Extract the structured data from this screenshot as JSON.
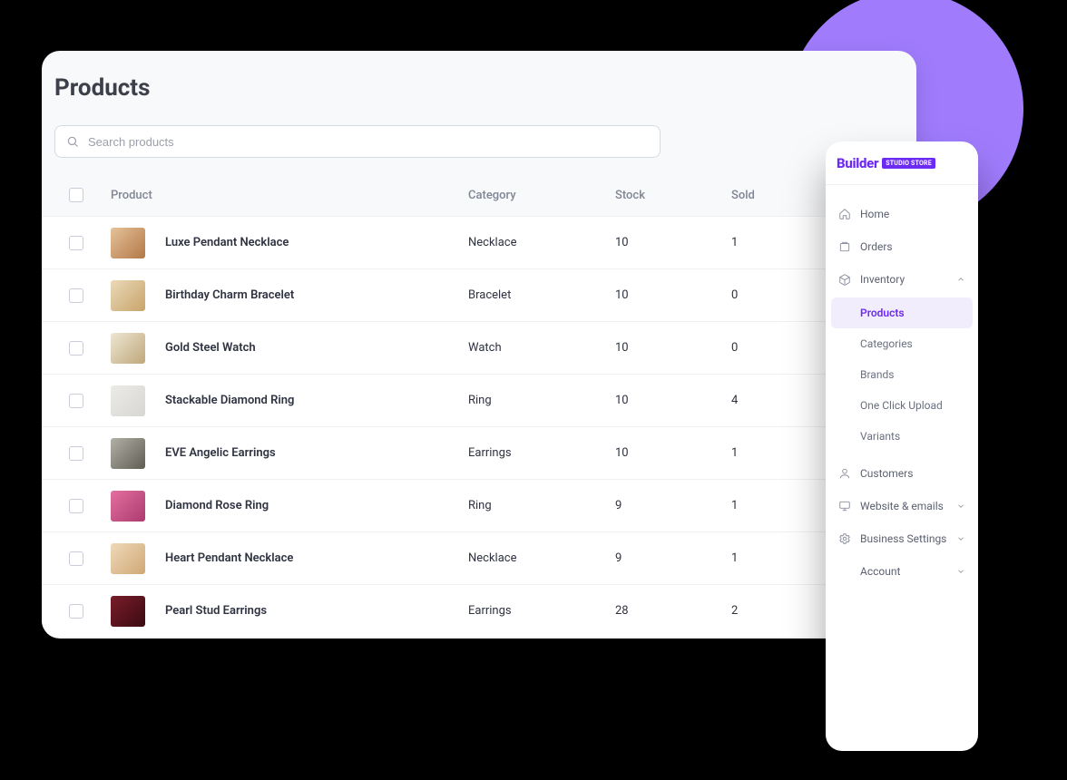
{
  "page": {
    "title": "Products",
    "search_placeholder": "Search products"
  },
  "columns": {
    "product": "Product",
    "category": "Category",
    "stock": "Stock",
    "sold": "Sold"
  },
  "products": [
    {
      "name": "Luxe Pendant Necklace",
      "category": "Necklace",
      "stock": "10",
      "sold": "1"
    },
    {
      "name": "Birthday Charm Bracelet",
      "category": "Bracelet",
      "stock": "10",
      "sold": "0"
    },
    {
      "name": "Gold Steel Watch",
      "category": "Watch",
      "stock": "10",
      "sold": "0"
    },
    {
      "name": "Stackable Diamond Ring",
      "category": "Ring",
      "stock": "10",
      "sold": "4"
    },
    {
      "name": "EVE Angelic Earrings",
      "category": "Earrings",
      "stock": "10",
      "sold": "1"
    },
    {
      "name": "Diamond Rose Ring",
      "category": "Ring",
      "stock": "9",
      "sold": "1"
    },
    {
      "name": "Heart Pendant Necklace",
      "category": "Necklace",
      "stock": "9",
      "sold": "1"
    },
    {
      "name": "Pearl Stud Earrings",
      "category": "Earrings",
      "stock": "28",
      "sold": "2"
    }
  ],
  "brand": {
    "word": "Builder",
    "badge": "STUDIO STORE"
  },
  "nav": {
    "home": "Home",
    "orders": "Orders",
    "inventory": "Inventory",
    "inventory_sub": {
      "products": "Products",
      "categories": "Categories",
      "brands": "Brands",
      "one_click": "One Click Upload",
      "variants": "Variants"
    },
    "customers": "Customers",
    "website": "Website & emails",
    "business": "Business Settings",
    "account": "Account"
  }
}
